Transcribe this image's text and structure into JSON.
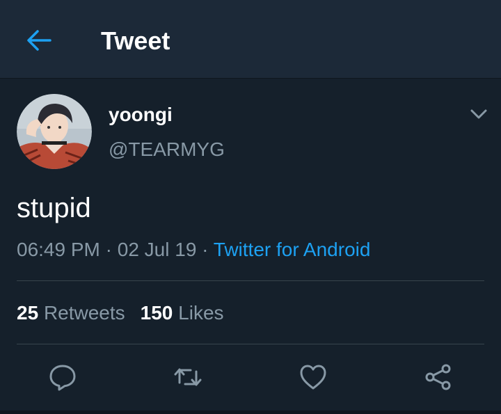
{
  "header": {
    "title": "Tweet",
    "back_icon": "arrow-left-icon"
  },
  "tweet": {
    "author": {
      "display_name": "yoongi",
      "handle": "@TEARMYG",
      "avatar_icon": "avatar-photo"
    },
    "text": "stupid",
    "time": "06:49 PM",
    "date": "02 Jul 19",
    "separator": "·",
    "source": "Twitter for Android",
    "stats": {
      "retweets_count": "25",
      "retweets_label": "Retweets",
      "likes_count": "150",
      "likes_label": "Likes"
    },
    "actions": [
      {
        "icon": "reply-icon"
      },
      {
        "icon": "retweet-icon"
      },
      {
        "icon": "like-icon"
      },
      {
        "icon": "share-icon"
      }
    ]
  },
  "colors": {
    "background": "#15202b",
    "header_background": "#1c2938",
    "accent": "#1da1f2",
    "secondary_text": "#8899a6",
    "divider": "#38444d"
  }
}
